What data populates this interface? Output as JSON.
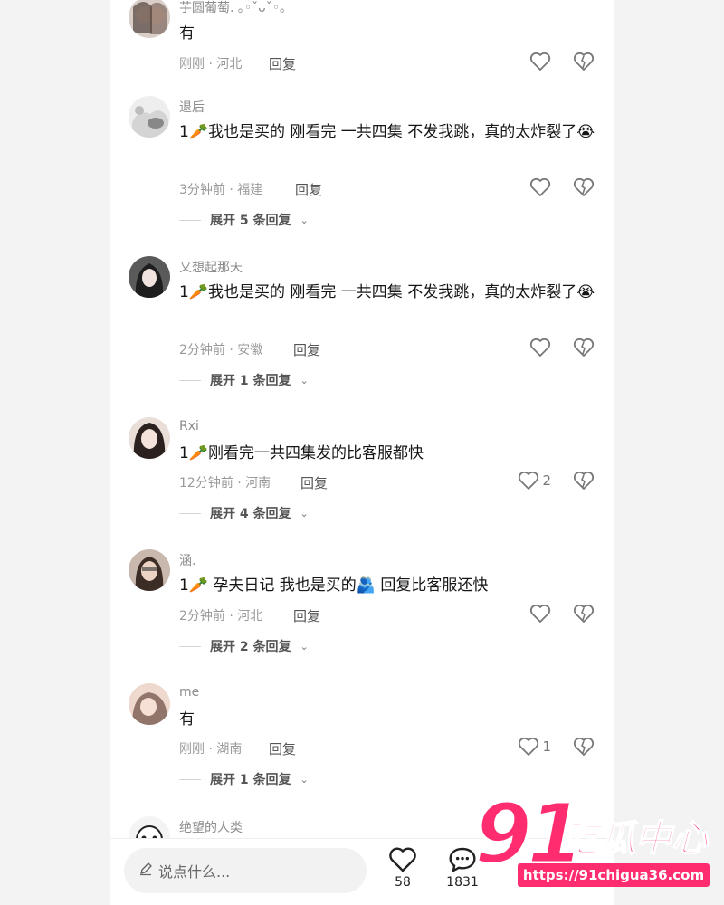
{
  "comments": [
    {
      "username": "芋圆葡萄. ｡◦ˇᴗˇ◦｡",
      "text": "有",
      "time_location": "刚刚 · 河北",
      "reply_label": "回复",
      "likes": "",
      "expand_label": ""
    },
    {
      "username": "退后",
      "text": "1🥕我也是买的 刚看完 一共四集 不发我跳，真的太炸裂了😭",
      "time_location": "3分钟前 · 福建",
      "reply_label": "回复",
      "likes": "",
      "expand_label": "展开 5 条回复"
    },
    {
      "username": "又想起那天",
      "text": "1🥕我也是买的 刚看完 一共四集 不发我跳，真的太炸裂了😭",
      "time_location": "2分钟前 · 安徽",
      "reply_label": "回复",
      "likes": "",
      "expand_label": "展开 1 条回复"
    },
    {
      "username": "Rxi",
      "text": "1🥕刚看完一共四集发的比客服都快",
      "time_location": "12分钟前 · 河南",
      "reply_label": "回复",
      "likes": "2",
      "expand_label": "展开 4 条回复"
    },
    {
      "username": "涵.",
      "text": "1🥕 孕夫日记 我也是买的🫂 回复比客服还快",
      "time_location": "2分钟前 · 河北",
      "reply_label": "回复",
      "likes": "",
      "expand_label": "展开 2 条回复"
    },
    {
      "username": "me",
      "text": "有",
      "time_location": "刚刚 · 湖南",
      "reply_label": "回复",
      "likes": "1",
      "expand_label": "展开 1 条回复"
    },
    {
      "username": "绝望的人类"
    }
  ],
  "bottom_bar": {
    "input_placeholder": "说点什么...",
    "like_count": "58",
    "comment_count": "1831"
  },
  "watermark": {
    "number": "91",
    "name": "吃瓜中心",
    "url": "https://91chigua36.com"
  },
  "icons": {
    "heart": "heart-outline-icon",
    "dislike": "broken-heart-icon",
    "pencil": "pencil-icon",
    "comment": "speech-bubble-icon",
    "chevron": "chevron-down-icon"
  },
  "colors": {
    "accent": "#ff2d6f",
    "text": "#161616",
    "muted": "#9a9a9a"
  }
}
